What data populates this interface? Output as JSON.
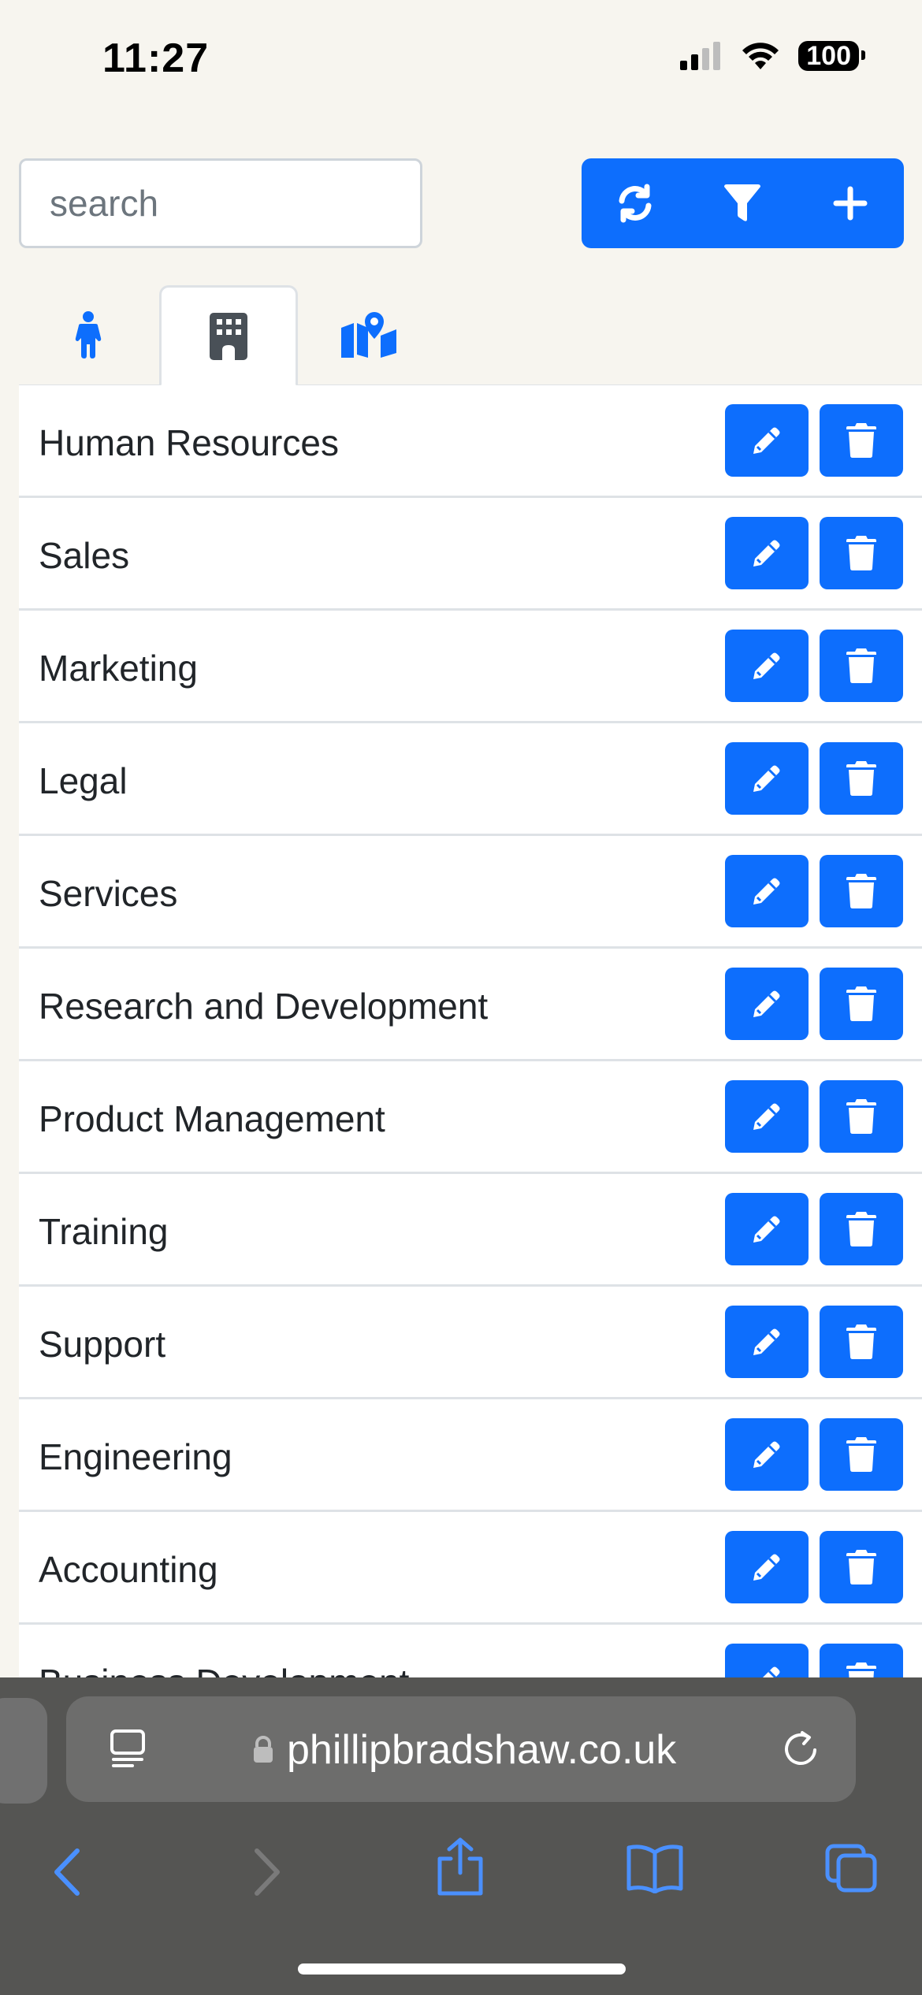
{
  "status_bar": {
    "time": "11:27",
    "battery": "100"
  },
  "search": {
    "placeholder": "search",
    "value": ""
  },
  "toolbar": {
    "buttons": [
      "refresh-icon",
      "filter-icon",
      "add-icon"
    ]
  },
  "tabs": [
    {
      "icon": "person-icon",
      "active": false
    },
    {
      "icon": "building-icon",
      "active": true
    },
    {
      "icon": "map-location-icon",
      "active": false
    }
  ],
  "departments": [
    "Human Resources",
    "Sales",
    "Marketing",
    "Legal",
    "Services",
    "Research and Development",
    "Product Management",
    "Training",
    "Support",
    "Engineering",
    "Accounting",
    "Business Development"
  ],
  "browser": {
    "url": "phillipbradshaw.co.uk"
  },
  "colors": {
    "primary": "#0d6efd",
    "background": "#f7f5ef",
    "browser_chrome": "#555553",
    "browser_icon": "#4a90ff"
  }
}
